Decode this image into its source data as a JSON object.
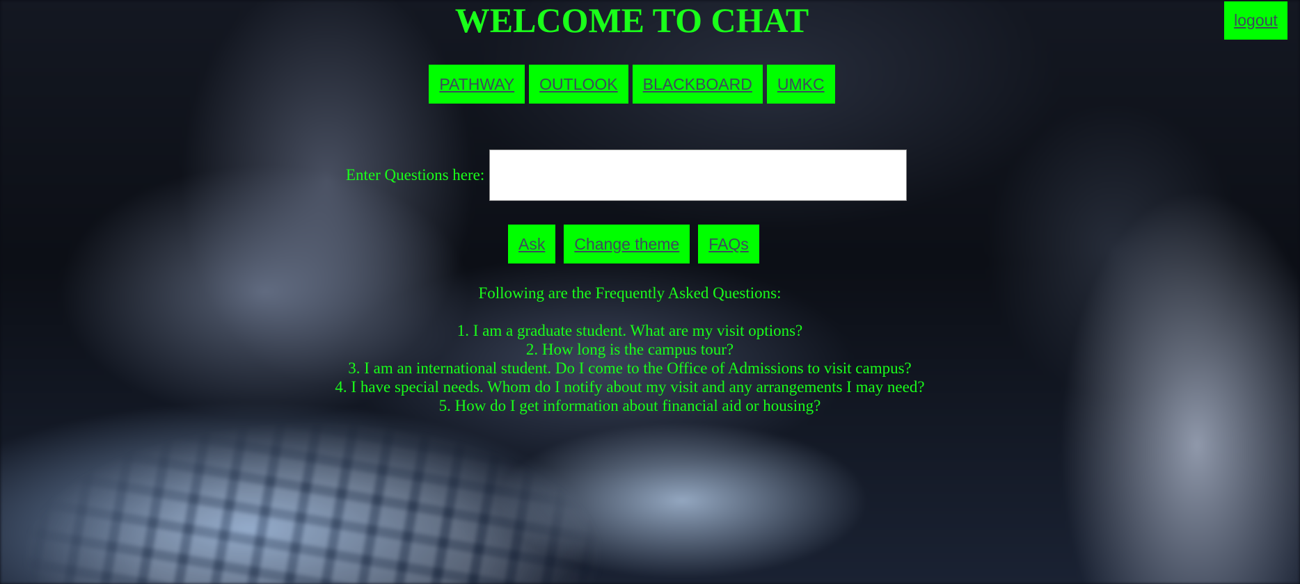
{
  "header": {
    "title": "WELCOME TO CHAT",
    "logout_label": "logout"
  },
  "nav": {
    "links": [
      {
        "label": "PATHWAY"
      },
      {
        "label": "OUTLOOK"
      },
      {
        "label": "BLACKBOARD"
      },
      {
        "label": "UMKC"
      }
    ]
  },
  "question": {
    "label": "Enter Questions here:",
    "value": "",
    "placeholder": ""
  },
  "actions": {
    "ask_label": "Ask",
    "change_theme_label": "Change theme",
    "faqs_label": "FAQs"
  },
  "faq": {
    "heading": "Following are the Frequently Asked Questions:",
    "items": [
      "1. I am a graduate student. What are my visit options?",
      "2. How long is the campus tour?",
      "3. I am an international student. Do I come to the Office of Admissions to visit campus?",
      "4. I have special needs. Whom do I notify about my visit and any arrangements I may need?",
      "5. How do I get information about financial aid or housing?"
    ]
  },
  "colors": {
    "accent": "#00ff00",
    "text": "#1aff1a",
    "button_text": "#3d4a5c"
  }
}
